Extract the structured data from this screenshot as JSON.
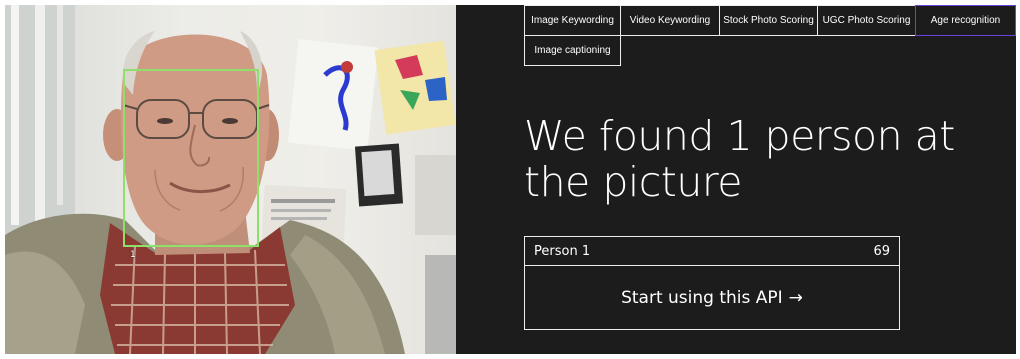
{
  "tabs": [
    {
      "label": "Image Keywording",
      "active": false
    },
    {
      "label": "Video Keywording",
      "active": false
    },
    {
      "label": "Stock Photo Scoring",
      "active": false
    },
    {
      "label": "UGC Photo Scoring",
      "active": false
    },
    {
      "label": "Age recognition",
      "active": true
    },
    {
      "label": "Image captioning",
      "active": false
    }
  ],
  "headline": "We found 1 person at the picture",
  "face_index_label": "1",
  "results": [
    {
      "label": "Person 1",
      "age": "69"
    }
  ],
  "cta": {
    "label": "Start using this API",
    "arrow": "→"
  },
  "colors": {
    "background": "#1c1c1c",
    "active_tab_border": "#6b42d8",
    "face_box": "#8fe06a",
    "text": "#ffffff"
  }
}
